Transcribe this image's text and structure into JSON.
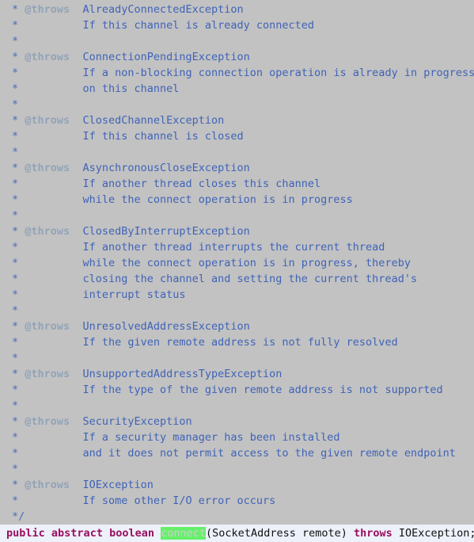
{
  "editor": {
    "background_color": "#c2c2c2",
    "comment_asterisk_color": "#4a6bb8",
    "javadoc_tag_color": "#93a3b8",
    "javadoc_text_color": "#3f63b8",
    "signature_background_color": "#edf1fa",
    "keyword_color": "#9b0f5f",
    "selection_background_color": "#66f06a",
    "selection_text_color": "#cfcfcf"
  },
  "javadoc": {
    "lines": [
      {
        "asterisk": "*",
        "tag": "@throws",
        "text": "AlreadyConnectedException"
      },
      {
        "asterisk": "*",
        "tag": "",
        "text": "If this channel is already connected"
      },
      {
        "asterisk": "*",
        "tag": "",
        "text": ""
      },
      {
        "asterisk": "*",
        "tag": "@throws",
        "text": "ConnectionPendingException"
      },
      {
        "asterisk": "*",
        "tag": "",
        "text": "If a non-blocking connection operation is already in progress"
      },
      {
        "asterisk": "*",
        "tag": "",
        "text": "on this channel"
      },
      {
        "asterisk": "*",
        "tag": "",
        "text": ""
      },
      {
        "asterisk": "*",
        "tag": "@throws",
        "text": "ClosedChannelException"
      },
      {
        "asterisk": "*",
        "tag": "",
        "text": "If this channel is closed"
      },
      {
        "asterisk": "*",
        "tag": "",
        "text": ""
      },
      {
        "asterisk": "*",
        "tag": "@throws",
        "text": "AsynchronousCloseException"
      },
      {
        "asterisk": "*",
        "tag": "",
        "text": "If another thread closes this channel"
      },
      {
        "asterisk": "*",
        "tag": "",
        "text": "while the connect operation is in progress"
      },
      {
        "asterisk": "*",
        "tag": "",
        "text": ""
      },
      {
        "asterisk": "*",
        "tag": "@throws",
        "text": "ClosedByInterruptException"
      },
      {
        "asterisk": "*",
        "tag": "",
        "text": "If another thread interrupts the current thread"
      },
      {
        "asterisk": "*",
        "tag": "",
        "text": "while the connect operation is in progress, thereby"
      },
      {
        "asterisk": "*",
        "tag": "",
        "text": "closing the channel and setting the current thread's"
      },
      {
        "asterisk": "*",
        "tag": "",
        "text": "interrupt status"
      },
      {
        "asterisk": "*",
        "tag": "",
        "text": ""
      },
      {
        "asterisk": "*",
        "tag": "@throws",
        "text": "UnresolvedAddressException"
      },
      {
        "asterisk": "*",
        "tag": "",
        "text": "If the given remote address is not fully resolved"
      },
      {
        "asterisk": "*",
        "tag": "",
        "text": ""
      },
      {
        "asterisk": "*",
        "tag": "@throws",
        "text": "UnsupportedAddressTypeException"
      },
      {
        "asterisk": "*",
        "tag": "",
        "text": "If the type of the given remote address is not supported"
      },
      {
        "asterisk": "*",
        "tag": "",
        "text": ""
      },
      {
        "asterisk": "*",
        "tag": "@throws",
        "text": "SecurityException"
      },
      {
        "asterisk": "*",
        "tag": "",
        "text": "If a security manager has been installed"
      },
      {
        "asterisk": "*",
        "tag": "",
        "text": "and it does not permit access to the given remote endpoint"
      },
      {
        "asterisk": "*",
        "tag": "",
        "text": ""
      },
      {
        "asterisk": "*",
        "tag": "@throws",
        "text": "IOException"
      },
      {
        "asterisk": "*",
        "tag": "",
        "text": "If some other I/O error occurs"
      },
      {
        "asterisk": "*/",
        "tag": "",
        "text": ""
      }
    ]
  },
  "signature": {
    "modifier_public": "public",
    "modifier_abstract": "abstract",
    "return_type": "boolean",
    "method_name": "connect",
    "params": "(SocketAddress remote)",
    "throws_keyword": "throws",
    "exception_type": "IOException;"
  }
}
